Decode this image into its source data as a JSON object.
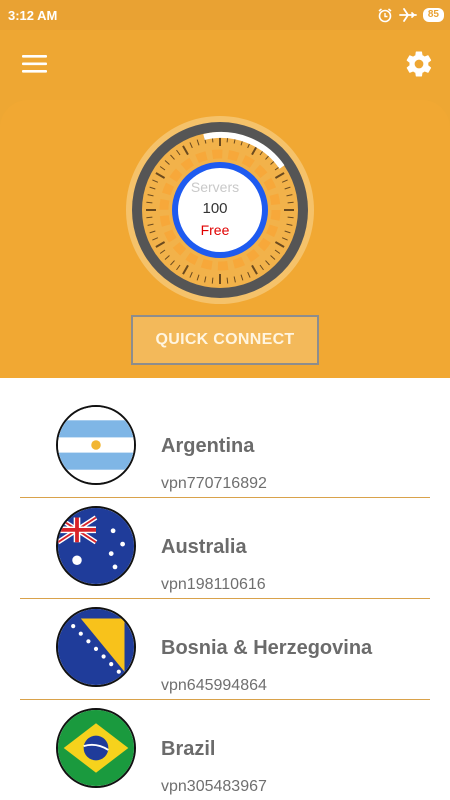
{
  "status_bar": {
    "time": "3:12 AM",
    "battery": "85",
    "icons": [
      "alarm-icon",
      "airplane-mode-icon",
      "battery-icon"
    ]
  },
  "app_bar": {
    "icons": [
      "menu-icon",
      "settings-icon"
    ]
  },
  "gauge": {
    "label": "Servers",
    "count": "100",
    "tier": "Free"
  },
  "quick_connect_label": "QUICK CONNECT",
  "servers": [
    {
      "country": "Argentina",
      "host": "vpn770716892",
      "flag": "argentina-flag"
    },
    {
      "country": "Australia",
      "host": "vpn198110616",
      "flag": "australia-flag"
    },
    {
      "country": "Bosnia & Herzegovina",
      "host": "vpn645994864",
      "flag": "bosnia-herzegovina-flag"
    },
    {
      "country": "Brazil",
      "host": "vpn305483967",
      "flag": "brazil-flag"
    }
  ],
  "colors": {
    "primary": "#eea733",
    "accent_red": "#e00000",
    "ring_blue": "#1e5bf0",
    "divider": "#d9a24b"
  }
}
